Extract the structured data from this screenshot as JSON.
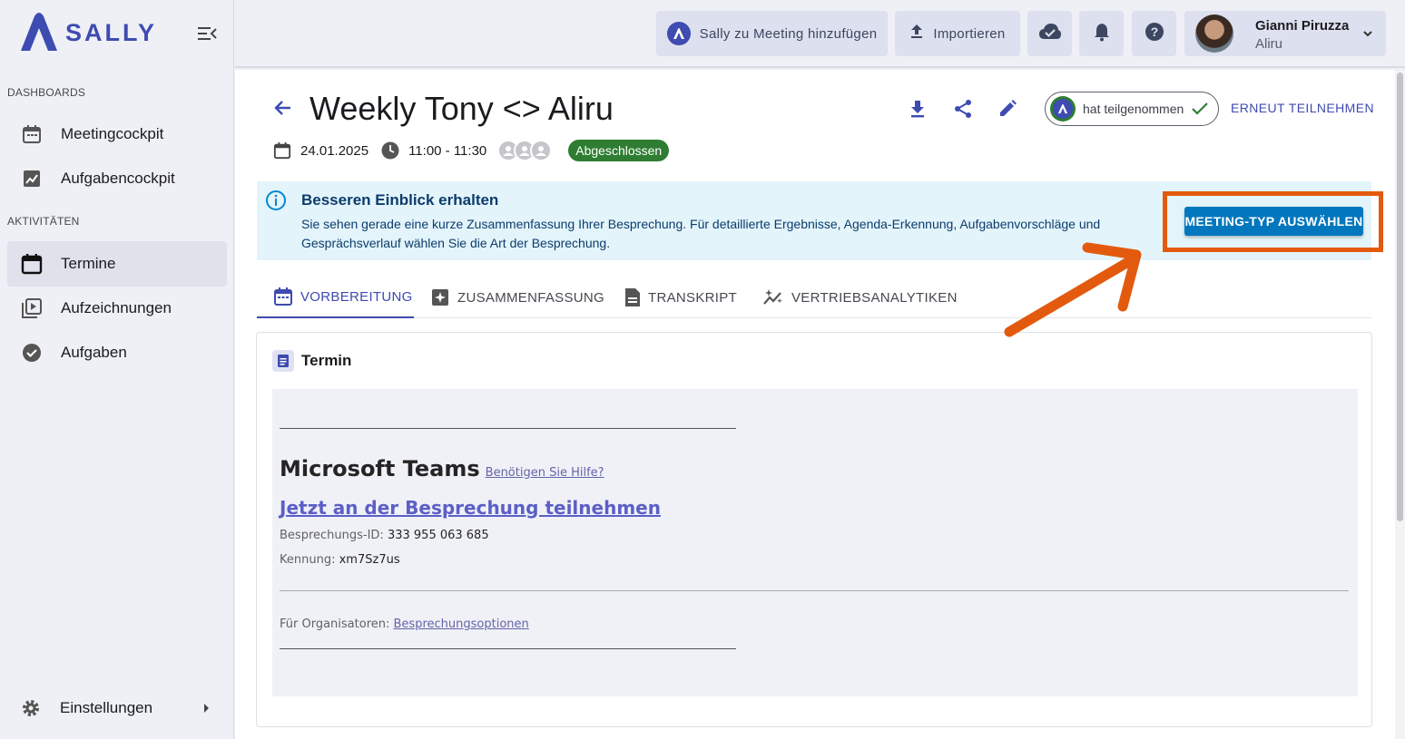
{
  "app": {
    "logo_text": "SALLY",
    "accent": "#3e4bb0"
  },
  "sidebar": {
    "section_dashboards": "DASHBOARDS",
    "section_activities": "AKTIVITÄTEN",
    "items": [
      {
        "label": "Meetingcockpit",
        "icon": "calendar-icon"
      },
      {
        "label": "Aufgabencockpit",
        "icon": "chart-icon"
      },
      {
        "label": "Termine",
        "icon": "calendar-icon",
        "active": true
      },
      {
        "label": "Aufzeichnungen",
        "icon": "video-library-icon"
      },
      {
        "label": "Aufgaben",
        "icon": "check-circle-icon"
      }
    ],
    "settings_label": "Einstellungen"
  },
  "topbar": {
    "add_sally": "Sally zu Meeting hinzufügen",
    "import": "Importieren",
    "user_name": "Gianni Piruzza",
    "user_org": "Aliru"
  },
  "meeting": {
    "title": "Weekly Tony <> Aliru",
    "date": "24.01.2025",
    "time": "11:00 - 11:30",
    "status": "Abgeschlossen",
    "status_color": "#2e7d32",
    "attended_label": "hat teilgenommen",
    "rejoin_label": "ERNEUT TEILNEHMEN"
  },
  "info_banner": {
    "heading": "Besseren Einblick erhalten",
    "text": "Sie sehen gerade eine kurze Zusammenfassung Ihrer Besprechung. Für detaillierte Ergebnisse, Agenda-Erkennung, Aufgabenvorschläge und Gesprächsverlauf wählen Sie die Art der Besprechung.",
    "button": "MEETING-TYP AUSWÄHLEN",
    "highlight_color": "#e35a0e"
  },
  "tabs": [
    {
      "label": "VORBEREITUNG",
      "active": true
    },
    {
      "label": "ZUSAMMENFASSUNG"
    },
    {
      "label": "TRANSKRIPT"
    },
    {
      "label": "VERTRIEBSANALYTIKEN"
    }
  ],
  "card": {
    "title": "Termin",
    "teams_title": "Microsoft Teams",
    "help_link": "Benötigen Sie Hilfe?",
    "join_link": "Jetzt an der Besprechung teilnehmen",
    "meeting_id_label": "Besprechungs-ID:",
    "meeting_id": "333 955 063 685",
    "passcode_label": "Kennung:",
    "passcode": "xm7Sz7us",
    "organizer_label": "Für Organisatoren:",
    "organizer_link": "Besprechungsoptionen"
  }
}
